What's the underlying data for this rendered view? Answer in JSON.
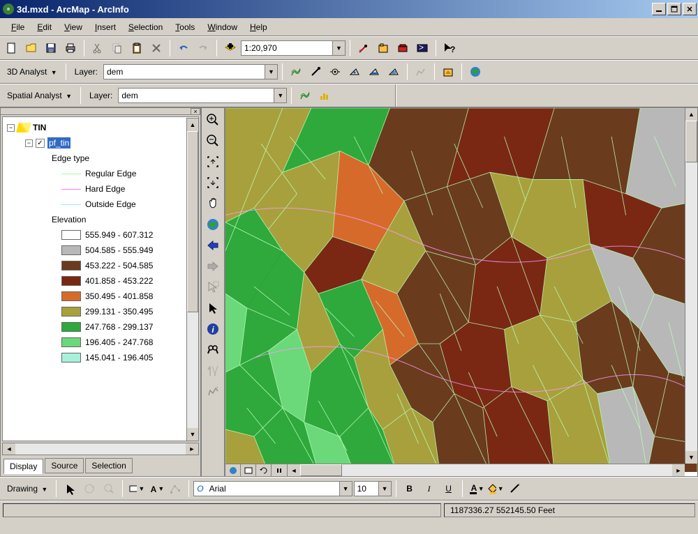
{
  "title": "3d.mxd - ArcMap - ArcInfo",
  "menu": [
    "File",
    "Edit",
    "View",
    "Insert",
    "Selection",
    "Tools",
    "Window",
    "Help"
  ],
  "toolbar1": {
    "scale": "1:20,970"
  },
  "toolbar2": {
    "label": "3D Analyst",
    "layerLabel": "Layer:",
    "layer": "dem"
  },
  "toolbar3": {
    "label": "Spatial Analyst",
    "layerLabel": "Layer:",
    "layer": "dem"
  },
  "toc": {
    "root": "TIN",
    "layer": "pf_tin",
    "edgeHeader": "Edge type",
    "edges": [
      {
        "label": "Regular Edge",
        "color": "#9eff9e"
      },
      {
        "label": "Hard Edge",
        "color": "#ff77ff"
      },
      {
        "label": "Outside Edge",
        "color": "#a0e8ff"
      }
    ],
    "elevHeader": "Elevation",
    "classes": [
      {
        "label": "555.949 - 607.312",
        "color": null
      },
      {
        "label": "504.585 - 555.949",
        "color": "#b8b8b8"
      },
      {
        "label": "453.222 - 504.585",
        "color": "#6b3b1d"
      },
      {
        "label": "401.858 - 453.222",
        "color": "#7a2813"
      },
      {
        "label": "350.495 - 401.858",
        "color": "#d66a2b"
      },
      {
        "label": "299.131 - 350.495",
        "color": "#a8a03c"
      },
      {
        "label": "247.768 - 299.137",
        "color": "#2fa83c"
      },
      {
        "label": "196.405 - 247.768",
        "color": "#6bd87a"
      },
      {
        "label": "145.041 - 196.405",
        "color": "#a8f0da"
      }
    ],
    "tabs": [
      "Display",
      "Source",
      "Selection"
    ]
  },
  "drawing": {
    "label": "Drawing",
    "font": "Arial",
    "size": "10"
  },
  "status": {
    "coords": "1187336.27 552145.50 Feet"
  }
}
